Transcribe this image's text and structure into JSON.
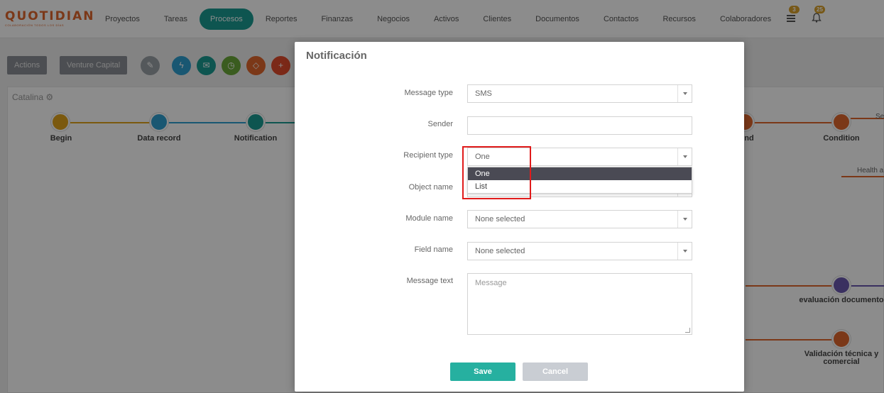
{
  "brand": {
    "name": "QUOTIDIAN",
    "tagline": "COLABORACIÓN TODOS LOS DÍAS"
  },
  "nav": [
    {
      "label": "Proyectos",
      "active": false
    },
    {
      "label": "Tareas",
      "active": false
    },
    {
      "label": "Procesos",
      "active": true
    },
    {
      "label": "Reportes",
      "active": false
    },
    {
      "label": "Finanzas",
      "active": false
    },
    {
      "label": "Negocios",
      "active": false
    },
    {
      "label": "Activos",
      "active": false
    },
    {
      "label": "Clientes",
      "active": false
    },
    {
      "label": "Documentos",
      "active": false
    },
    {
      "label": "Contactos",
      "active": false
    },
    {
      "label": "Recursos",
      "active": false
    },
    {
      "label": "Colaboradores",
      "active": false
    }
  ],
  "topbar": {
    "tasks_badge": "3",
    "notifications_badge": "25"
  },
  "toolbar": {
    "actions_label": "Actions",
    "venture_label": "Venture Capital"
  },
  "canvas": {
    "title": "Catalina",
    "nodes": [
      {
        "label": "Begin",
        "color": "#e0a21a"
      },
      {
        "label": "Data record",
        "color": "#2f9fd0"
      },
      {
        "label": "Notification",
        "color": "#1a9b92"
      },
      {
        "label": "nd",
        "color": "#e0662c"
      },
      {
        "label": "Condition",
        "color": "#e0662c"
      },
      {
        "label": "evaluación documento",
        "color": "#6b58b0"
      },
      {
        "label": "Validación técnica y comercial",
        "color": "#e0662c"
      }
    ],
    "edge_labels": [
      "Se",
      "Health a"
    ]
  },
  "modal": {
    "title": "Notificación",
    "fields": {
      "message_type": {
        "label": "Message type",
        "value": "SMS"
      },
      "sender": {
        "label": "Sender",
        "value": ""
      },
      "recipient_type": {
        "label": "Recipient type",
        "value": "One"
      },
      "object_name": {
        "label": "Object name"
      },
      "module_name": {
        "label": "Module name",
        "value": "None selected"
      },
      "field_name": {
        "label": "Field name",
        "value": "None selected"
      },
      "message_text": {
        "label": "Message text",
        "placeholder": "Message"
      }
    },
    "recipient_options": [
      "One",
      "List"
    ],
    "save_label": "Save",
    "cancel_label": "Cancel"
  },
  "colors": {
    "accent": "#1a9b92",
    "brand": "#e0662c",
    "save": "#26b0a0",
    "highlight": "#e01b1b"
  }
}
